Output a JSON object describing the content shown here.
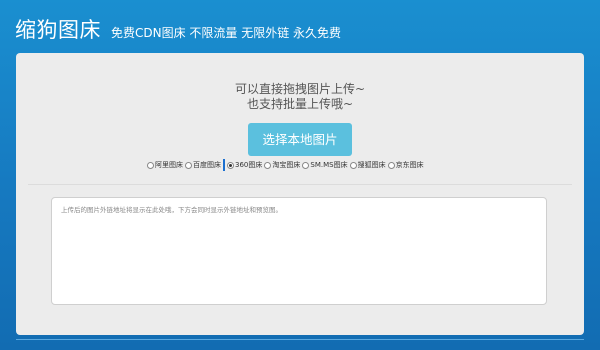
{
  "header": {
    "title": "缩狗图床",
    "tagline": "免费CDN图床 不限流量 无限外链 永久免费"
  },
  "upload": {
    "hint_line1": "可以直接拖拽图片上传~",
    "hint_line2": "也支持批量上传哦~",
    "select_button_label": "选择本地图片"
  },
  "hosts": {
    "selected": "360图床",
    "options": [
      {
        "label": "阿里图床",
        "checked": false
      },
      {
        "label": "百度图床",
        "checked": false
      },
      {
        "label": "360图床",
        "checked": true
      },
      {
        "label": "淘宝图床",
        "checked": false
      },
      {
        "label": "SM.MS图床",
        "checked": false
      },
      {
        "label": "搜狐图床",
        "checked": false
      },
      {
        "label": "京东图床",
        "checked": false
      }
    ]
  },
  "result": {
    "placeholder": "上传后的图片外链地址将显示在此处哦，下方会同时显示外链地址和预览图。"
  },
  "colors": {
    "background": "#1a8fd0",
    "button": "#5bc0de",
    "panel": "#ececec"
  }
}
